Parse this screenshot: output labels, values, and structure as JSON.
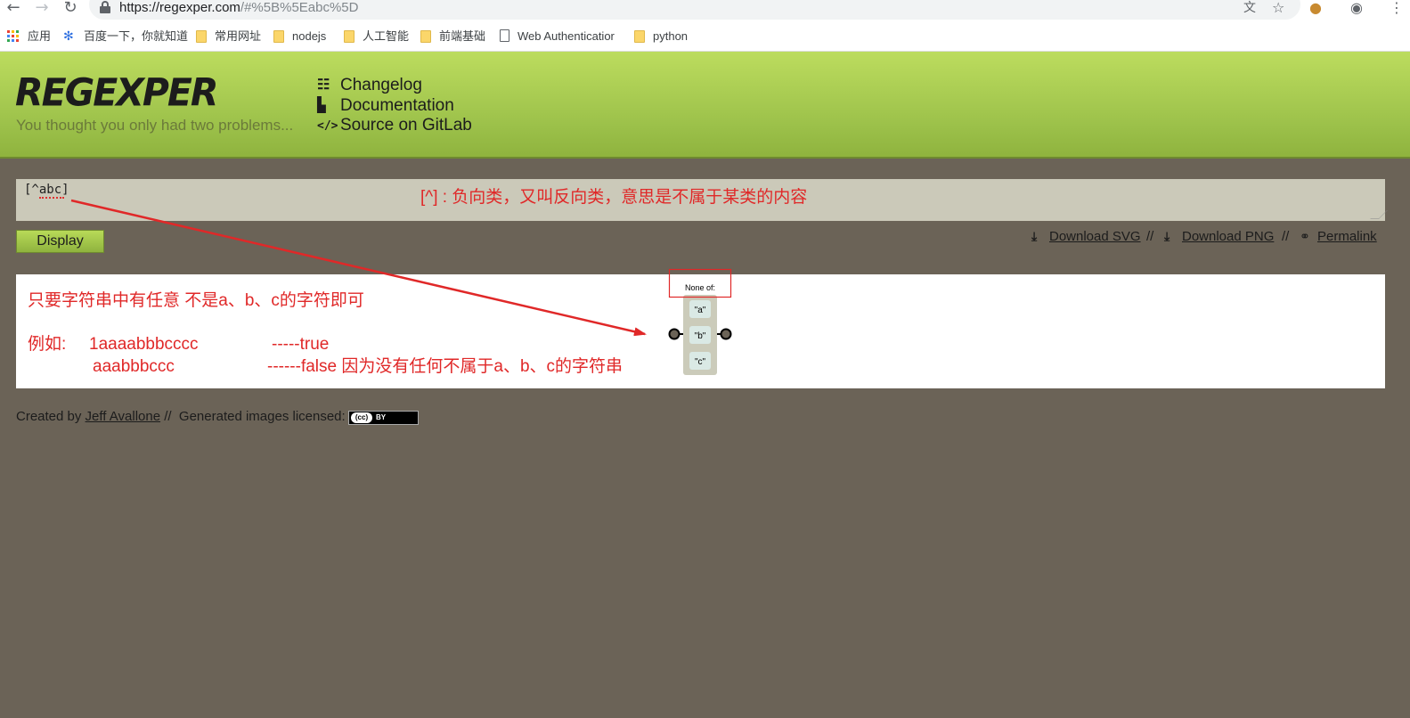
{
  "browser": {
    "url_host": "https://regexper.com",
    "url_rest": "/#%5B%5Eabc%5D",
    "bookmarks": [
      {
        "label": "应用",
        "icon": "apps-grid-icon"
      },
      {
        "label": "百度一下，你就知道",
        "icon": "baidu-paw-icon"
      },
      {
        "label": "常用网址",
        "icon": "folder-icon"
      },
      {
        "label": "nodejs",
        "icon": "folder-icon"
      },
      {
        "label": "人工智能",
        "icon": "folder-icon"
      },
      {
        "label": "前端基础",
        "icon": "folder-icon"
      },
      {
        "label": "Web Authenticatior",
        "icon": "page-icon"
      },
      {
        "label": "python",
        "icon": "folder-icon"
      }
    ]
  },
  "header": {
    "logo": "REGEXPER",
    "tagline": "You thought you only had two problems...",
    "nav": [
      {
        "label": "Changelog",
        "icon": "list-icon"
      },
      {
        "label": "Documentation",
        "icon": "document-icon"
      },
      {
        "label": "Source on GitLab",
        "icon": "code-icon"
      }
    ]
  },
  "editor": {
    "value": "[^abc]",
    "display_label": "Display"
  },
  "downloads": {
    "svg_label": "Download SVG",
    "png_label": "Download PNG",
    "permalink_label": "Permalink",
    "separator": "//"
  },
  "diagram": {
    "group_label": "None of:",
    "items": [
      "\"a\"",
      "\"b\"",
      "\"c\""
    ]
  },
  "annotations": {
    "top": "[^] : 负向类，又叫反向类，意思是不属于某类的内容",
    "line1": "只要字符串中有任意 不是a、b、c的字符即可",
    "example_label": "例如:",
    "ex1_input": "1aaaabbbcccc",
    "ex1_result": "-----true",
    "ex2_input": "aaabbbccc",
    "ex2_result": "------false 因为没有任何不属于a、b、c的字符串"
  },
  "footer": {
    "created_by": "Created by",
    "author": "Jeff Avallone",
    "separator": "//",
    "license_text": "Generated images licensed:",
    "badge_cc": "(cc)",
    "badge_by": "BY"
  },
  "colors": {
    "header_green": "#a9cc4f",
    "page_background": "#6b6357",
    "annotation_red": "#e02828",
    "textarea_bg": "#cbc9b9"
  }
}
